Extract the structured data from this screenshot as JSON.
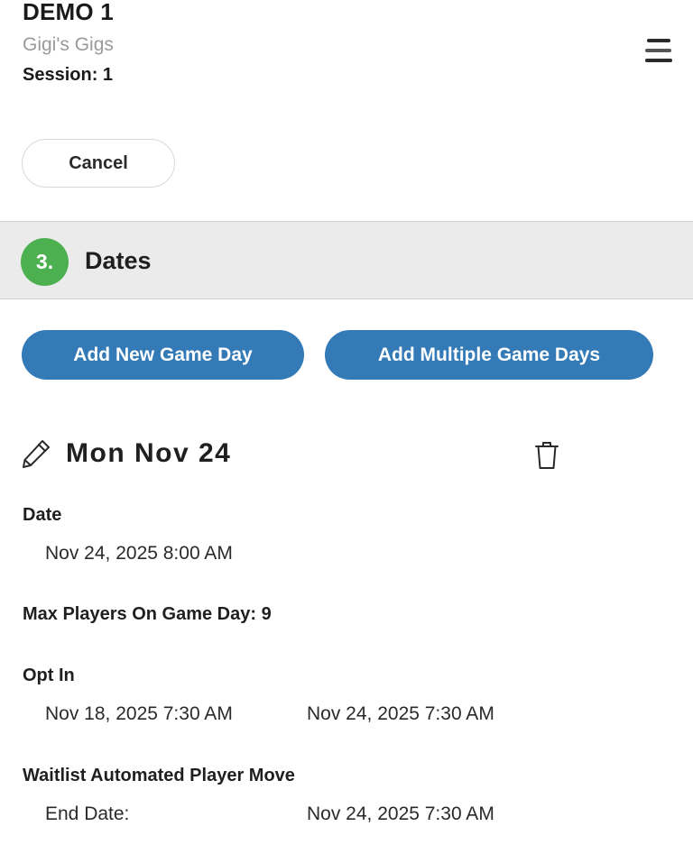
{
  "header": {
    "title": "DEMO 1",
    "subtitle": "Gigi's Gigs",
    "session_label": "Session: 1",
    "menu_icon": "hamburger-menu-icon"
  },
  "actions": {
    "cancel_label": "Cancel"
  },
  "step": {
    "number": "3.",
    "title": "Dates",
    "badge_color": "#4caf50"
  },
  "buttons": {
    "add_new_game_day": "Add New Game Day",
    "add_multiple_game_days": "Add Multiple Game Days",
    "primary_color": "#337ab7"
  },
  "game_day": {
    "title": "Mon Nov 24",
    "edit_icon": "pencil-icon",
    "delete_icon": "trash-icon",
    "date_label": "Date",
    "date_value": "Nov 24, 2025 8:00 AM",
    "max_players_label": "Max Players On Game Day: 9",
    "opt_in_label": "Opt In",
    "opt_in_start": "Nov 18, 2025 7:30 AM",
    "opt_in_end": "Nov 24, 2025 7:30 AM",
    "waitlist_label": "Waitlist Automated Player Move",
    "end_date_label": "End Date:",
    "end_date_value": "Nov 24, 2025 7:30 AM"
  }
}
